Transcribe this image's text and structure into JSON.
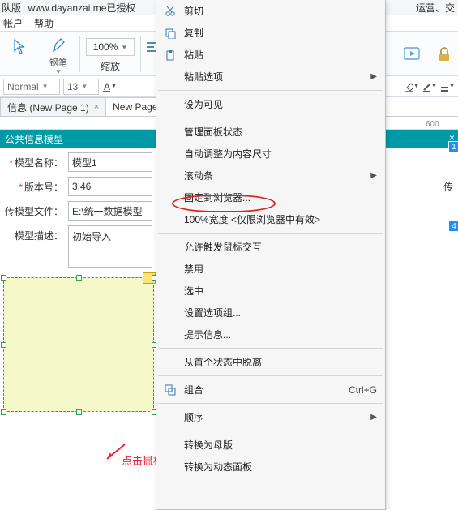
{
  "title_url": ": www.dayanzai.me已授权 ",
  "title_suffix": "队版",
  "title_right": "运营、交",
  "menubar": {
    "account": "帐户",
    "help": "帮助"
  },
  "toolbar": {
    "pen_label": "钢笔",
    "zoom_value": "100%",
    "zoom_label": "缩放",
    "lock_label": "锁"
  },
  "formatbar": {
    "style": "Normal",
    "size": "13"
  },
  "tabs": {
    "t0": "信息 (New Page 1)",
    "t1": "New Page 1"
  },
  "band_title": "公共信息模型",
  "form": {
    "model_name_label": "模型名称：",
    "model_name_value": "模型1",
    "version_label": "版本号：",
    "version_value": "3.46",
    "file_label": "传模型文件：",
    "file_value": "E:\\统一数据模型",
    "upload": "传",
    "desc_label": "模型描述：",
    "desc_value": "初始导入"
  },
  "badges": {
    "b1": "1",
    "b4": "4"
  },
  "annotation": "点击鼠标右键",
  "ctx": {
    "cut": "剪切",
    "copy": "复制",
    "paste": "粘贴",
    "paste_opts": "粘贴选项",
    "set_visible": "设为可见",
    "panel_state": "管理面板状态",
    "auto_fit": "自动调整为内容尺寸",
    "scroll": "滚动条",
    "pin": "固定到浏览器...",
    "width100": "100%宽度 <仅限浏览器中有效>",
    "mouse": "允许触发鼠标交互",
    "disable": "禁用",
    "select": "选中",
    "options": "设置选项组...",
    "tooltip": "提示信息...",
    "detach": "从首个状态中脱离",
    "group": "组合",
    "group_sc": "Ctrl+G",
    "order": "顺序",
    "to_master": "转换为母版",
    "to_dynpanel": "转换为动态面板"
  }
}
